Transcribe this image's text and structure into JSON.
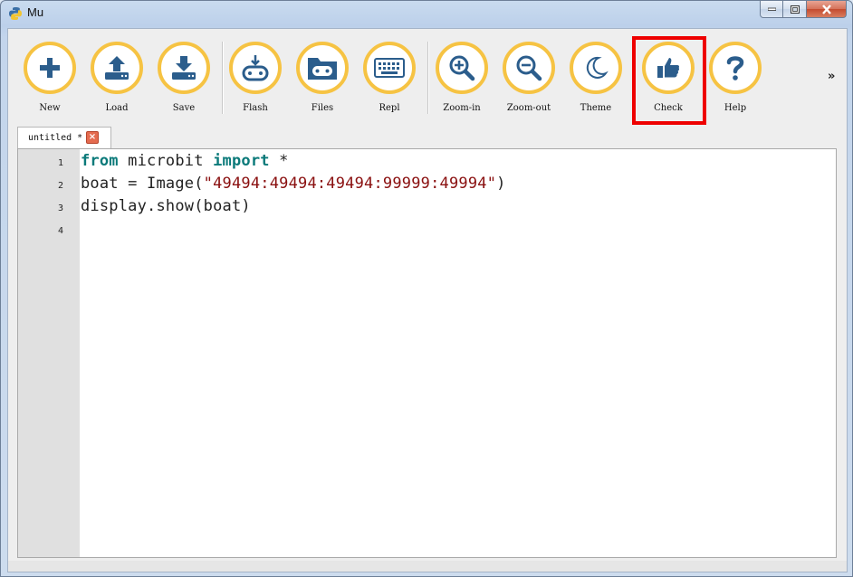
{
  "window": {
    "title": "Mu"
  },
  "toolbar": {
    "buttons": [
      {
        "id": "new",
        "label": "New",
        "icon": "plus-icon"
      },
      {
        "id": "load",
        "label": "Load",
        "icon": "upload-icon"
      },
      {
        "id": "save",
        "label": "Save",
        "icon": "download-icon"
      },
      {
        "id": "flash",
        "label": "Flash",
        "icon": "microbit-flash-icon"
      },
      {
        "id": "files",
        "label": "Files",
        "icon": "microbit-files-icon"
      },
      {
        "id": "repl",
        "label": "Repl",
        "icon": "keyboard-icon"
      },
      {
        "id": "zoom-in",
        "label": "Zoom-in",
        "icon": "zoom-in-icon"
      },
      {
        "id": "zoom-out",
        "label": "Zoom-out",
        "icon": "zoom-out-icon"
      },
      {
        "id": "theme",
        "label": "Theme",
        "icon": "moon-icon"
      },
      {
        "id": "check",
        "label": "Check",
        "icon": "thumbs-up-icon"
      },
      {
        "id": "help",
        "label": "Help",
        "icon": "question-icon"
      }
    ],
    "overflow_label": "»",
    "accent_color": "#f6c343",
    "icon_color": "#2b5d8c",
    "highlight_color": "#ee0000"
  },
  "tabs": [
    {
      "label": "untitled *",
      "close_icon": "close-icon"
    }
  ],
  "editor": {
    "line_numbers": [
      "1",
      "2",
      "3",
      "4"
    ],
    "lines": [
      [
        {
          "t": "from",
          "k": "kw"
        },
        {
          "t": " microbit ",
          "k": ""
        },
        {
          "t": "import",
          "k": "kw"
        },
        {
          "t": " *",
          "k": ""
        }
      ],
      [
        {
          "t": "boat = Image(",
          "k": ""
        },
        {
          "t": "\"49494:49494:49494:99999:49994\"",
          "k": "str"
        },
        {
          "t": ")",
          "k": ""
        }
      ],
      [
        {
          "t": "display.show(boat)",
          "k": ""
        }
      ],
      []
    ]
  }
}
